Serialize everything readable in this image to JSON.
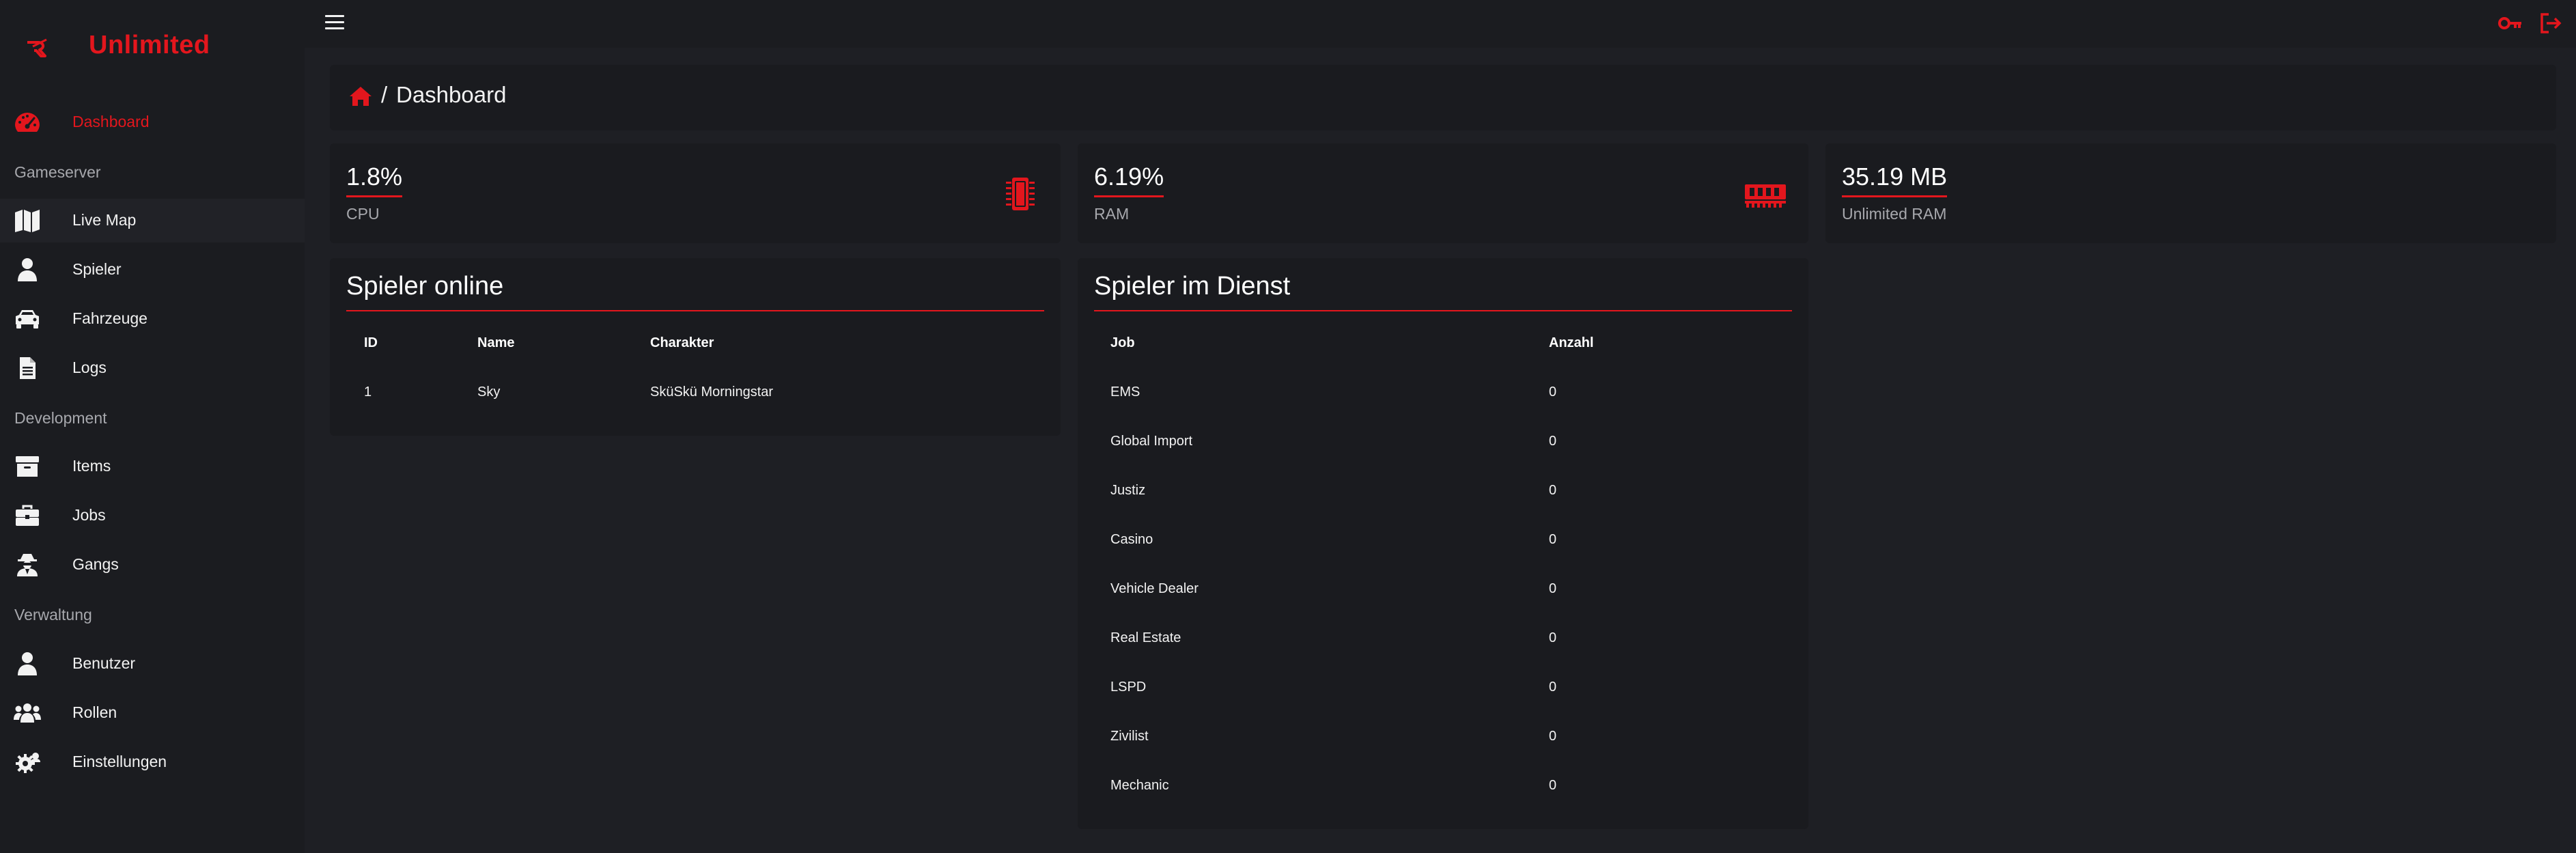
{
  "brand": {
    "name": "Unlimited"
  },
  "sidebar": {
    "items": [
      {
        "label": "Dashboard",
        "icon": "tachometer-icon"
      },
      {
        "label": "Live Map",
        "icon": "map-icon"
      },
      {
        "label": "Spieler",
        "icon": "user-icon"
      },
      {
        "label": "Fahrzeuge",
        "icon": "car-icon"
      },
      {
        "label": "Logs",
        "icon": "file-icon"
      },
      {
        "label": "Items",
        "icon": "archive-icon"
      },
      {
        "label": "Jobs",
        "icon": "briefcase-icon"
      },
      {
        "label": "Gangs",
        "icon": "user-secret-icon"
      },
      {
        "label": "Benutzer",
        "icon": "user-icon"
      },
      {
        "label": "Rollen",
        "icon": "users-icon"
      },
      {
        "label": "Einstellungen",
        "icon": "user-cog-icon"
      }
    ],
    "sections": [
      "Gameserver",
      "Development",
      "Verwaltung"
    ]
  },
  "topbar": {
    "icons": [
      "menu-icon",
      "key-icon",
      "logout-icon"
    ]
  },
  "breadcrumb": {
    "separator": "/",
    "page": "Dashboard"
  },
  "stats": [
    {
      "value": "1.8%",
      "label": "CPU",
      "icon": "microchip-icon"
    },
    {
      "value": "6.19%",
      "label": "RAM",
      "icon": "memory-icon"
    },
    {
      "value": "35.19 MB",
      "label": "Unlimited RAM"
    }
  ],
  "players_online": {
    "title": "Spieler online",
    "columns": [
      "ID",
      "Name",
      "Charakter"
    ],
    "rows": [
      [
        "1",
        "Sky",
        "SküSkü Morningstar"
      ]
    ]
  },
  "players_on_duty": {
    "title": "Spieler im Dienst",
    "columns": [
      "Job",
      "Anzahl"
    ],
    "rows": [
      [
        "EMS",
        "0"
      ],
      [
        "Global Import",
        "0"
      ],
      [
        "Justiz",
        "0"
      ],
      [
        "Casino",
        "0"
      ],
      [
        "Vehicle Dealer",
        "0"
      ],
      [
        "Real Estate",
        "0"
      ],
      [
        "LSPD",
        "0"
      ],
      [
        "Zivilist",
        "0"
      ],
      [
        "Mechanic",
        "0"
      ]
    ]
  },
  "colors": {
    "accent": "#e3161d",
    "background": "#1e1f24",
    "sidebar": "#1b1c20",
    "card": "#1a1b1f",
    "muted_text": "#a7a8ad"
  }
}
